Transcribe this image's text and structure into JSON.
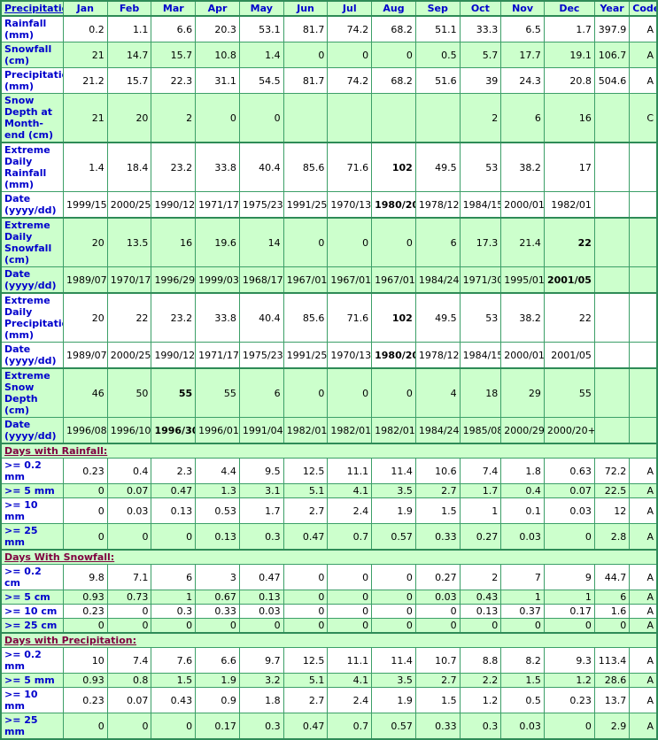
{
  "table": {
    "corner_label": "Precipitation:",
    "columns": [
      "Jan",
      "Feb",
      "Mar",
      "Apr",
      "May",
      "Jun",
      "Jul",
      "Aug",
      "Sep",
      "Oct",
      "Nov",
      "Dec",
      "Year",
      "Code"
    ],
    "sections": [
      {
        "banner": null,
        "rows": [
          {
            "label": "Rainfall (mm)",
            "shade": "white",
            "values": [
              "0.2",
              "1.1",
              "6.6",
              "20.3",
              "53.1",
              "81.7",
              "74.2",
              "68.2",
              "51.1",
              "33.3",
              "6.5",
              "1.7",
              "397.9",
              "A"
            ],
            "bold": []
          },
          {
            "label": "Snowfall (cm)",
            "shade": "green",
            "values": [
              "21",
              "14.7",
              "15.7",
              "10.8",
              "1.4",
              "0",
              "0",
              "0",
              "0.5",
              "5.7",
              "17.7",
              "19.1",
              "106.7",
              "A"
            ],
            "bold": []
          },
          {
            "label": "Precipitation (mm)",
            "shade": "white",
            "values": [
              "21.2",
              "15.7",
              "22.3",
              "31.1",
              "54.5",
              "81.7",
              "74.2",
              "68.2",
              "51.6",
              "39",
              "24.3",
              "20.8",
              "504.6",
              "A"
            ],
            "bold": []
          },
          {
            "label": "Snow Depth at Month-end (cm)",
            "shade": "green",
            "values": [
              "21",
              "20",
              "2",
              "0",
              "0",
              "",
              "",
              "",
              "",
              "2",
              "6",
              "16",
              "",
              "C"
            ],
            "bold": [],
            "thickbottom": true
          },
          {
            "label": "Extreme Daily Rainfall (mm)",
            "shade": "white",
            "values": [
              "1.4",
              "18.4",
              "23.2",
              "33.8",
              "40.4",
              "85.6",
              "71.6",
              "102",
              "49.5",
              "53",
              "38.2",
              "17",
              "",
              ""
            ],
            "bold": [
              7
            ]
          },
          {
            "label": "Date (yyyy/dd)",
            "shade": "white",
            "values": [
              "1999/15",
              "2000/25",
              "1990/12",
              "1971/17",
              "1975/23",
              "1991/25",
              "1970/13",
              "1980/20",
              "1978/12",
              "1984/15",
              "2000/01",
              "1982/01",
              "",
              ""
            ],
            "bold": [
              7
            ],
            "thickbottom": true
          },
          {
            "label": "Extreme Daily Snowfall (cm)",
            "shade": "green",
            "values": [
              "20",
              "13.5",
              "16",
              "19.6",
              "14",
              "0",
              "0",
              "0",
              "6",
              "17.3",
              "21.4",
              "22",
              "",
              ""
            ],
            "bold": [
              11
            ]
          },
          {
            "label": "Date (yyyy/dd)",
            "shade": "green",
            "values": [
              "1989/07",
              "1970/17",
              "1996/29",
              "1999/03",
              "1968/17",
              "1967/01+",
              "1967/01+",
              "1967/01+",
              "1984/24",
              "1971/30",
              "1995/01",
              "2001/05",
              "",
              ""
            ],
            "bold": [
              11
            ],
            "thickbottom": true
          },
          {
            "label": "Extreme Daily Precipitation (mm)",
            "shade": "white",
            "values": [
              "20",
              "22",
              "23.2",
              "33.8",
              "40.4",
              "85.6",
              "71.6",
              "102",
              "49.5",
              "53",
              "38.2",
              "22",
              "",
              ""
            ],
            "bold": [
              7
            ]
          },
          {
            "label": "Date (yyyy/dd)",
            "shade": "white",
            "values": [
              "1989/07",
              "2000/25",
              "1990/12",
              "1971/17",
              "1975/23",
              "1991/25",
              "1970/13",
              "1980/20",
              "1978/12",
              "1984/15",
              "2000/01",
              "2001/05",
              "",
              ""
            ],
            "bold": [
              7
            ],
            "thickbottom": true
          },
          {
            "label": "Extreme Snow Depth (cm)",
            "shade": "green",
            "values": [
              "46",
              "50",
              "55",
              "55",
              "6",
              "0",
              "0",
              "0",
              "4",
              "18",
              "29",
              "55",
              "",
              ""
            ],
            "bold": [
              2
            ]
          },
          {
            "label": "Date (yyyy/dd)",
            "shade": "green",
            "values": [
              "1996/08",
              "1996/10+",
              "1996/30",
              "1996/01",
              "1991/04",
              "1982/01+",
              "1982/01+",
              "1982/01+",
              "1984/24",
              "1985/08",
              "2000/29+",
              "2000/20+",
              "",
              ""
            ],
            "bold": [
              2
            ],
            "thickbottom": true
          }
        ]
      },
      {
        "banner": "Days with Rainfall:",
        "rows": [
          {
            "label": ">= 0.2 mm",
            "shade": "white",
            "values": [
              "0.23",
              "0.4",
              "2.3",
              "4.4",
              "9.5",
              "12.5",
              "11.1",
              "11.4",
              "10.6",
              "7.4",
              "1.8",
              "0.63",
              "72.2",
              "A"
            ],
            "bold": []
          },
          {
            "label": ">= 5 mm",
            "shade": "green",
            "values": [
              "0",
              "0.07",
              "0.47",
              "1.3",
              "3.1",
              "5.1",
              "4.1",
              "3.5",
              "2.7",
              "1.7",
              "0.4",
              "0.07",
              "22.5",
              "A"
            ],
            "bold": []
          },
          {
            "label": ">= 10 mm",
            "shade": "white",
            "values": [
              "0",
              "0.03",
              "0.13",
              "0.53",
              "1.7",
              "2.7",
              "2.4",
              "1.9",
              "1.5",
              "1",
              "0.1",
              "0.03",
              "12",
              "A"
            ],
            "bold": []
          },
          {
            "label": ">= 25 mm",
            "shade": "green",
            "values": [
              "0",
              "0",
              "0",
              "0.13",
              "0.3",
              "0.47",
              "0.7",
              "0.57",
              "0.33",
              "0.27",
              "0.03",
              "0",
              "2.8",
              "A"
            ],
            "bold": [],
            "thickbottom": true
          }
        ]
      },
      {
        "banner": "Days With Snowfall:",
        "rows": [
          {
            "label": ">= 0.2 cm",
            "shade": "white",
            "values": [
              "9.8",
              "7.1",
              "6",
              "3",
              "0.47",
              "0",
              "0",
              "0",
              "0.27",
              "2",
              "7",
              "9",
              "44.7",
              "A"
            ],
            "bold": []
          },
          {
            "label": ">= 5 cm",
            "shade": "green",
            "values": [
              "0.93",
              "0.73",
              "1",
              "0.67",
              "0.13",
              "0",
              "0",
              "0",
              "0.03",
              "0.43",
              "1",
              "1",
              "6",
              "A"
            ],
            "bold": []
          },
          {
            "label": ">= 10 cm",
            "shade": "white",
            "values": [
              "0.23",
              "0",
              "0.3",
              "0.33",
              "0.03",
              "0",
              "0",
              "0",
              "0",
              "0.13",
              "0.37",
              "0.17",
              "1.6",
              "A"
            ],
            "bold": []
          },
          {
            "label": ">= 25 cm",
            "shade": "green",
            "values": [
              "0",
              "0",
              "0",
              "0",
              "0",
              "0",
              "0",
              "0",
              "0",
              "0",
              "0",
              "0",
              "0",
              "A"
            ],
            "bold": [],
            "thickbottom": true
          }
        ]
      },
      {
        "banner": "Days with Precipitation:",
        "rows": [
          {
            "label": ">= 0.2 mm",
            "shade": "white",
            "values": [
              "10",
              "7.4",
              "7.6",
              "6.6",
              "9.7",
              "12.5",
              "11.1",
              "11.4",
              "10.7",
              "8.8",
              "8.2",
              "9.3",
              "113.4",
              "A"
            ],
            "bold": []
          },
          {
            "label": ">= 5 mm",
            "shade": "green",
            "values": [
              "0.93",
              "0.8",
              "1.5",
              "1.9",
              "3.2",
              "5.1",
              "4.1",
              "3.5",
              "2.7",
              "2.2",
              "1.5",
              "1.2",
              "28.6",
              "A"
            ],
            "bold": []
          },
          {
            "label": ">= 10 mm",
            "shade": "white",
            "values": [
              "0.23",
              "0.07",
              "0.43",
              "0.9",
              "1.8",
              "2.7",
              "2.4",
              "1.9",
              "1.5",
              "1.2",
              "0.5",
              "0.23",
              "13.7",
              "A"
            ],
            "bold": []
          },
          {
            "label": ">= 25 mm",
            "shade": "green",
            "values": [
              "0",
              "0",
              "0",
              "0.17",
              "0.3",
              "0.47",
              "0.7",
              "0.57",
              "0.33",
              "0.3",
              "0.03",
              "0",
              "2.9",
              "A"
            ],
            "bold": []
          }
        ]
      }
    ]
  },
  "colors": {
    "border": "#2e8b57",
    "grid": "#3c9f68",
    "shade_green": "#ccffcc",
    "header_text": "#0000cc",
    "section_text": "#800040"
  }
}
